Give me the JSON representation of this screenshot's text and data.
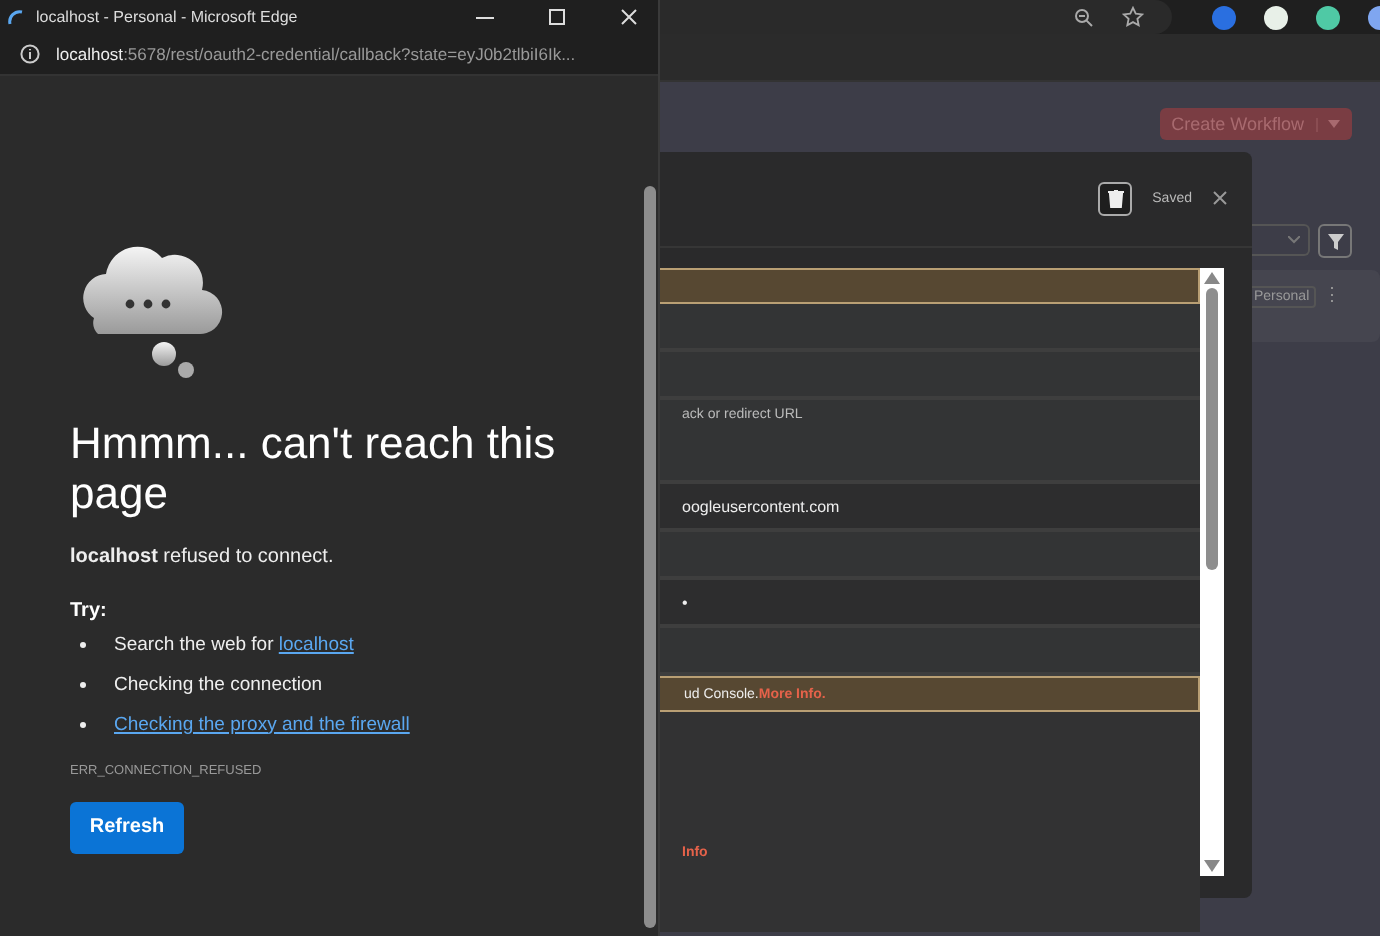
{
  "popup": {
    "title": "localhost - Personal - Microsoft Edge",
    "address": {
      "host": "localhost",
      "rest": ":5678/rest/oauth2-credential/callback?state=eyJ0b2tlbiI6Ik..."
    },
    "error": {
      "heading": "Hmmm... can't reach this page",
      "message": "**localhost** refused to connect.",
      "try_label": "Try:",
      "suggestions": [
        {
          "kind": "search",
          "text": "Search the web for ",
          "link": "localhost"
        },
        {
          "kind": "plain",
          "text": "Checking the connection"
        },
        {
          "kind": "link",
          "link": "Checking the proxy and the firewall"
        }
      ],
      "code": "ERR_CONNECTION_REFUSED",
      "button": "Refresh"
    }
  },
  "page": {
    "create_button": "Create Workflow",
    "card_tag": "Personal",
    "card_menu": "⋮"
  },
  "modal": {
    "status": "Saved",
    "rows": [
      {
        "kind": "notice"
      },
      {
        "kind": "row"
      },
      {
        "kind": "row"
      },
      {
        "kind": "row",
        "text": "ack or redirect URL"
      },
      {
        "kind": "field",
        "text": "oogleusercontent.com"
      },
      {
        "kind": "row"
      },
      {
        "kind": "field",
        "text": "•"
      },
      {
        "kind": "row"
      },
      {
        "kind": "notice",
        "text": "ud Console. ",
        "link": "More Info."
      },
      {
        "kind": "plain",
        "link": "Info"
      }
    ]
  }
}
